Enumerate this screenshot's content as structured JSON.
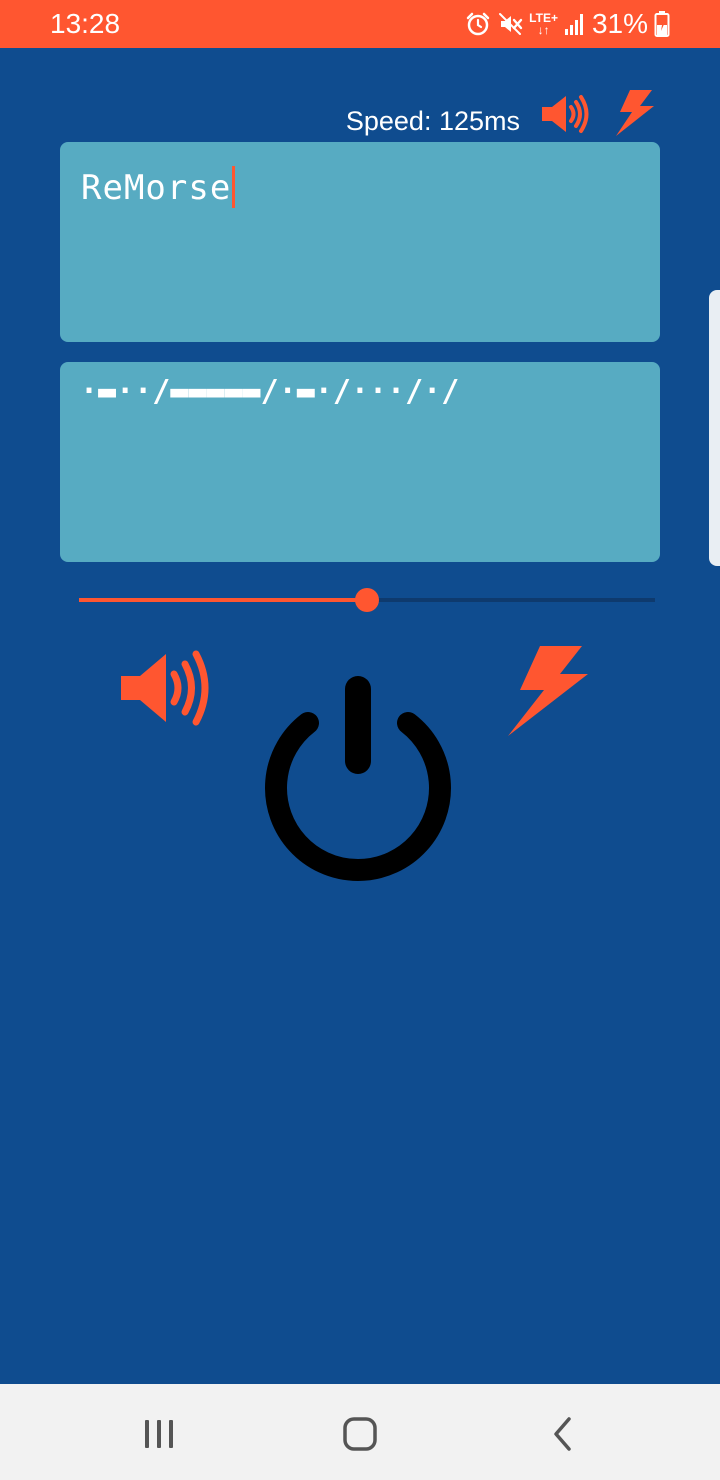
{
  "status_bar": {
    "time": "13:28",
    "network": "LTE+",
    "battery_percent": "31%",
    "icons": [
      "alarm-icon",
      "mute-icon",
      "lte-icon",
      "signal-icon",
      "battery-charging-icon"
    ]
  },
  "header": {
    "speed_label": "Speed: 125ms",
    "icons": [
      "sound-icon",
      "flash-icon"
    ]
  },
  "input": {
    "value": "ReMorse"
  },
  "output": {
    "morse": "·▬··/▬▬▬▬▬/·▬·/···/·/"
  },
  "slider": {
    "value_fraction": 0.5
  },
  "controls": {
    "icons": [
      "sound-icon",
      "flash-icon",
      "power-icon"
    ]
  },
  "nav_bar": {
    "icons": [
      "recents-icon",
      "home-icon",
      "back-icon"
    ]
  },
  "colors": {
    "accent": "#ff5630",
    "background": "#0f4c8f",
    "text_box": "#57abc2",
    "nav_bar": "#f2f2f2"
  }
}
